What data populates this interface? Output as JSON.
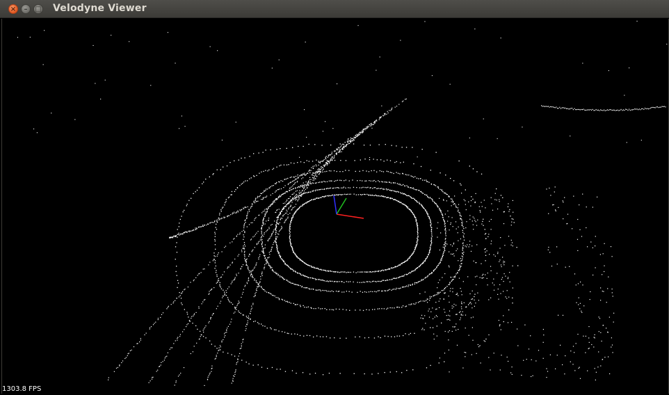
{
  "window": {
    "title": "Velodyne Viewer",
    "close_glyph": "×",
    "minimize_glyph": "–",
    "maximize_glyph": "□"
  },
  "viewer": {
    "fps_text": "1303.8 FPS",
    "background_color": "#000000",
    "point_color": "#ffffff",
    "axis_colors": {
      "x": "#ff2020",
      "y": "#20c020",
      "z": "#3030ff"
    }
  }
}
